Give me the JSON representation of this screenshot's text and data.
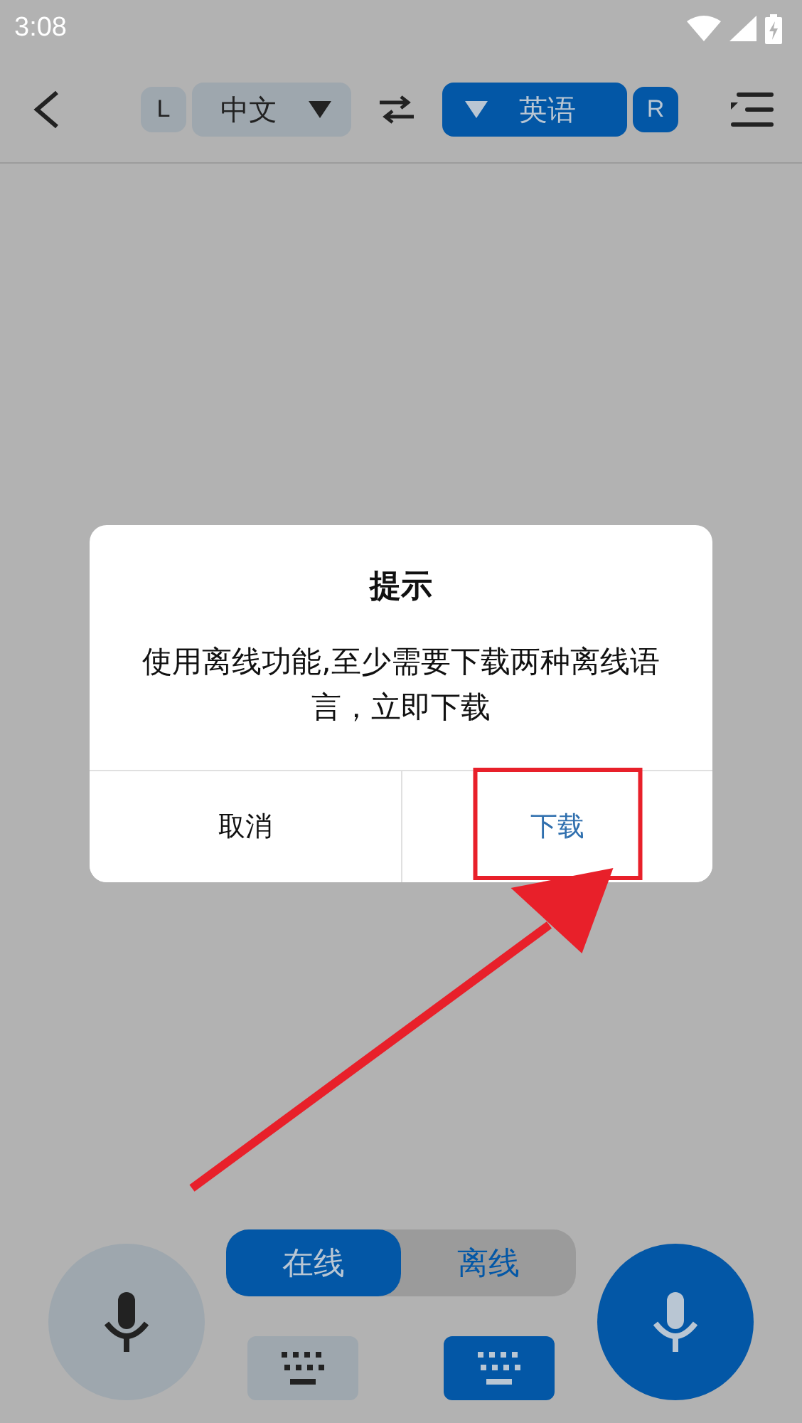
{
  "status_bar": {
    "time": "3:08"
  },
  "toolbar": {
    "languages": [
      {
        "badge": "L",
        "label": "中文",
        "active": false
      },
      {
        "badge": "R",
        "label": "英语",
        "active": true
      }
    ]
  },
  "dialog": {
    "title": "提示",
    "message": "使用离线功能,至少需要下载两种离线语言，立即下载",
    "buttons": [
      {
        "label": "取消",
        "kind": "cancel",
        "highlighted": false
      },
      {
        "label": "下载",
        "kind": "confirm",
        "highlighted": true
      }
    ]
  },
  "mode_toggle": [
    {
      "label": "在线",
      "selected": true
    },
    {
      "label": "离线",
      "selected": false
    }
  ],
  "input_controls": [
    {
      "active": false
    },
    {
      "active": true
    }
  ]
}
